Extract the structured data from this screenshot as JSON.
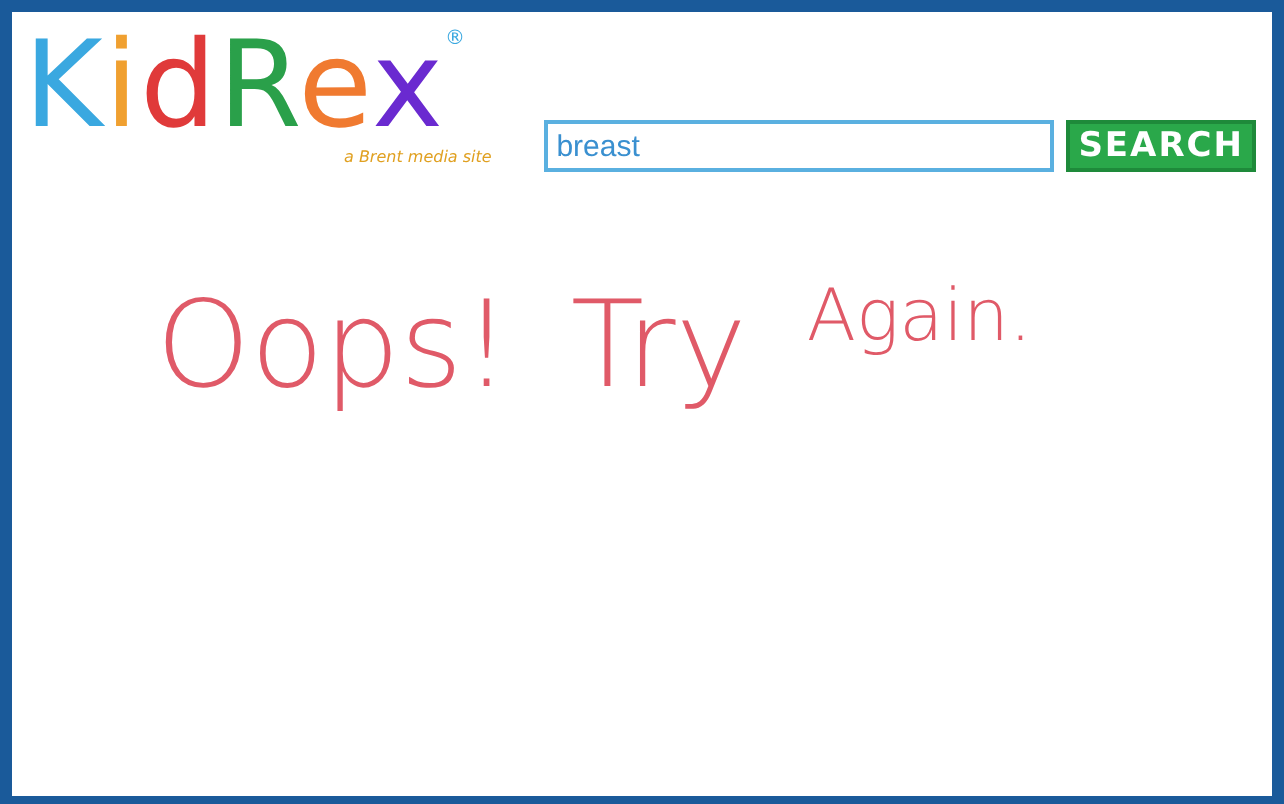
{
  "logo": {
    "letters": [
      {
        "char": "K",
        "color": "#3aa8e0"
      },
      {
        "char": "i",
        "color": "#f0a030"
      },
      {
        "char": "d",
        "color": "#e03a3a"
      },
      {
        "char": "R",
        "color": "#2aa04a"
      },
      {
        "char": "e",
        "color": "#f07a30"
      },
      {
        "char": "x",
        "color": "#6a2ad0"
      }
    ],
    "registered": "®",
    "tagline": "a Brent media site"
  },
  "search": {
    "value": "breast",
    "button": "SEARCH"
  },
  "message": [
    {
      "text": "Oops!",
      "kind": "large"
    },
    {
      "text": "Try",
      "kind": "large"
    },
    {
      "text": "Again.",
      "kind": "small"
    }
  ]
}
